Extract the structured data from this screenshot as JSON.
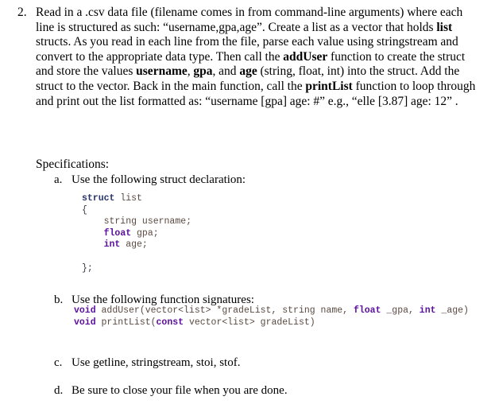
{
  "document": {
    "item": {
      "marker": "2.",
      "text_segments": [
        {
          "text": "Read in a .csv data file (filename comes in from command-line arguments) where each line is structured as such: “username,gpa,age”.  Create a list as a vector that holds ",
          "bold": false
        },
        {
          "text": "list",
          "bold": true
        },
        {
          "text": " structs. As you read in each line from the file, parse each value using stringstream and convert to the appropriate data type. Then call the ",
          "bold": false
        },
        {
          "text": "addUser",
          "bold": true
        },
        {
          "text": " function to create the struct and store the values ",
          "bold": false
        },
        {
          "text": "username",
          "bold": true
        },
        {
          "text": ", ",
          "bold": false
        },
        {
          "text": "gpa",
          "bold": true
        },
        {
          "text": ", and ",
          "bold": false
        },
        {
          "text": "age",
          "bold": true
        },
        {
          "text": " (string, float, int) into the struct.  Add the struct to the vector. Back in the main function, call the ",
          "bold": false
        },
        {
          "text": "printList",
          "bold": true
        },
        {
          "text": " function to loop through and print out the list formatted as: “username [gpa] age: #” e.g., “elle [3.87] age: 12” .",
          "bold": false
        }
      ]
    },
    "specifications_heading": "Specifications:",
    "sub_items": [
      {
        "marker": "a.",
        "text": "Use the following struct declaration:"
      },
      {
        "marker": "b.",
        "text": "Use the following function signatures:"
      },
      {
        "marker": "c.",
        "text": "Use getline, stringstream, stoi, stof."
      },
      {
        "marker": "d.",
        "text": "Be sure to close your file when you are done."
      }
    ],
    "code_struct": {
      "lines": [
        [
          {
            "t": "struct",
            "c": "kw-navy"
          },
          {
            "t": " list",
            "c": "plain"
          }
        ],
        [
          {
            "t": "{",
            "c": "punct"
          }
        ],
        [
          {
            "t": "    string username;",
            "c": "plain"
          }
        ],
        [
          {
            "t": "    ",
            "c": "plain"
          },
          {
            "t": "float",
            "c": "kw-purple"
          },
          {
            "t": " gpa;",
            "c": "plain"
          }
        ],
        [
          {
            "t": "    ",
            "c": "plain"
          },
          {
            "t": "int",
            "c": "kw-purple"
          },
          {
            "t": " age;",
            "c": "plain"
          }
        ],
        [
          {
            "t": "",
            "c": "plain"
          }
        ],
        [
          {
            "t": "};",
            "c": "punct"
          }
        ]
      ]
    },
    "code_signatures": {
      "lines": [
        [
          {
            "t": "void",
            "c": "kw-purple"
          },
          {
            "t": " addUser(vector<list> *gradeList, string name, ",
            "c": "plain"
          },
          {
            "t": "float",
            "c": "kw-purple"
          },
          {
            "t": " _gpa, ",
            "c": "plain"
          },
          {
            "t": "int",
            "c": "kw-purple"
          },
          {
            "t": " _age)",
            "c": "plain"
          }
        ],
        [
          {
            "t": "void",
            "c": "kw-purple"
          },
          {
            "t": " printList(",
            "c": "plain"
          },
          {
            "t": "const",
            "c": "kw-purple"
          },
          {
            "t": " vector<list> gradeList)",
            "c": "plain"
          }
        ]
      ]
    }
  },
  "colors": {
    "page_background": "#ffffff",
    "body_text": "#000000",
    "code_identifier": "#5a4a42",
    "code_keyword_navy": "#28346b",
    "code_keyword_purple": "#5b0f9e"
  }
}
